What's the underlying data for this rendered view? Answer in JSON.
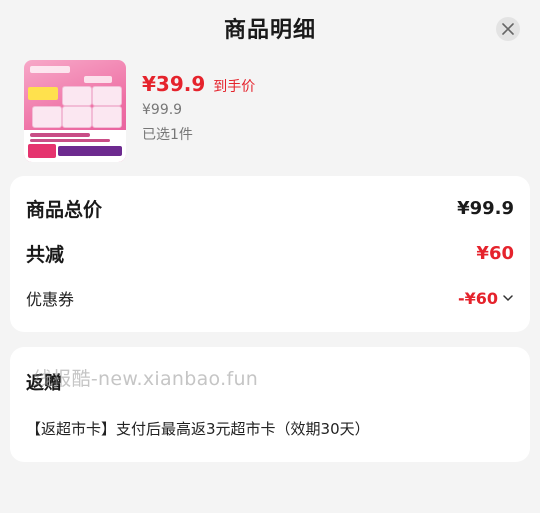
{
  "header": {
    "title": "商品明细"
  },
  "product": {
    "price_now": "¥39.9",
    "price_tag": "到手价",
    "price_original": "¥99.9",
    "selected": "已选1件"
  },
  "summary": {
    "total_label": "商品总价",
    "total_value": "¥99.9",
    "discount_label": "共减",
    "discount_value": "¥60",
    "coupon_label": "优惠券",
    "coupon_value": "-¥60"
  },
  "rebate": {
    "title": "返赠",
    "text": "【返超市卡】支付后最高返3元超市卡（效期30天）"
  },
  "watermark": "线报酷-new.xianbao.fun",
  "colors": {
    "accent_red": "#e5232c",
    "card_bg": "#ffffff",
    "page_bg": "#f4f4f4"
  }
}
